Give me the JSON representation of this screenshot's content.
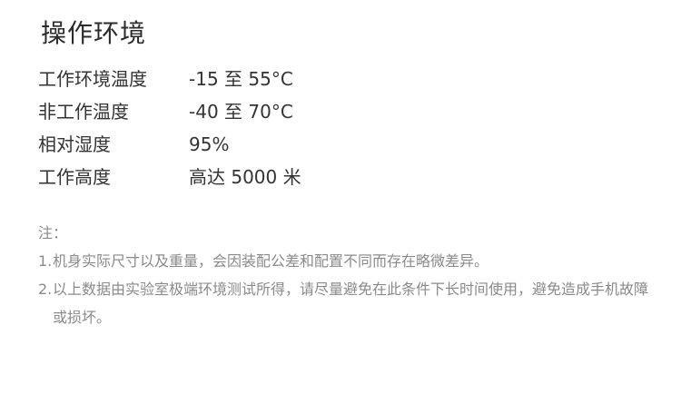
{
  "section": {
    "title": "操作环境"
  },
  "specs": [
    {
      "label": "工作环境温度",
      "value": "-15 至 55°C"
    },
    {
      "label": "非工作温度",
      "value": "-40 至 70°C"
    },
    {
      "label": "相对湿度",
      "value": "95%"
    },
    {
      "label": "工作高度",
      "value": "高达 5000 米"
    }
  ],
  "notes": {
    "title": "注：",
    "items": [
      {
        "num": "1.",
        "text": "机身实际尺寸以及重量，会因装配公差和配置不同而存在略微差异。"
      },
      {
        "num": "2.",
        "text": "以上数据由实验室极端环境测试所得，请尽量避免在此条件下长时间使用，避免造成手机故障或损坏。"
      }
    ]
  }
}
